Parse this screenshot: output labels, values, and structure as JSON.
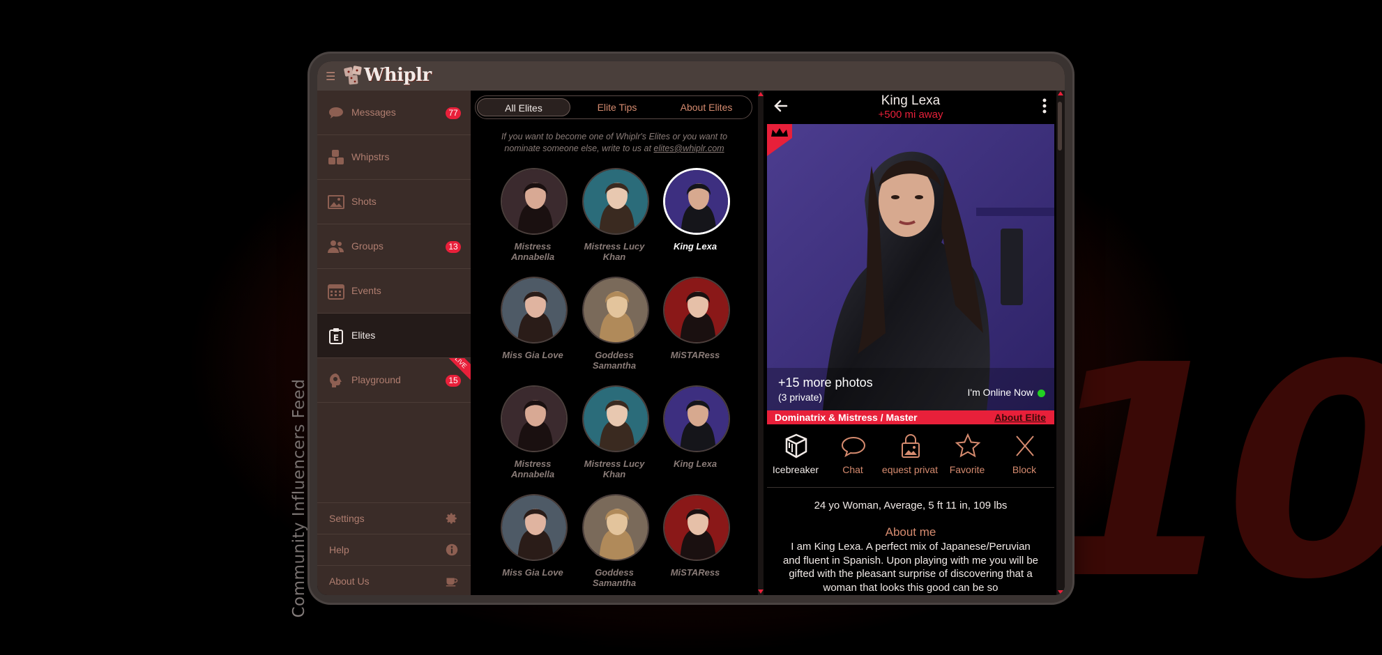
{
  "backdrop": {
    "big_number": "10",
    "vertical_caption": "Community Influencers Feed"
  },
  "app": {
    "name": "Whiplr"
  },
  "sidebar": {
    "items": [
      {
        "label": "Messages",
        "badge": "77",
        "icon": "speech-bubble-icon"
      },
      {
        "label": "Whipstrs",
        "badge": "",
        "icon": "dice-icon"
      },
      {
        "label": "Shots",
        "badge": "",
        "icon": "image-icon"
      },
      {
        "label": "Groups",
        "badge": "13",
        "icon": "people-icon"
      },
      {
        "label": "Events",
        "badge": "",
        "icon": "calendar-icon"
      },
      {
        "label": "Elites",
        "badge": "",
        "icon": "elite-badge-icon",
        "active": true
      },
      {
        "label": "Playground",
        "badge": "15",
        "icon": "playground-icon",
        "ribbon": "LIVE"
      }
    ],
    "bottom": [
      {
        "label": "Settings",
        "icon": "gear-icon"
      },
      {
        "label": "Help",
        "icon": "info-icon"
      },
      {
        "label": "About Us",
        "icon": "coffee-cup-icon"
      }
    ]
  },
  "elites": {
    "tabs": [
      "All Elites",
      "Elite Tips",
      "About Elites"
    ],
    "active_tab": "All Elites",
    "intro": "If you want to become one of Whiplr's Elites or you want to nominate someone else, write to us at",
    "email": "elites@whiplr.com",
    "cards": [
      {
        "name": "Mistress Annabella"
      },
      {
        "name": "Mistress Lucy Khan"
      },
      {
        "name": "King Lexa",
        "selected": true
      },
      {
        "name": "Miss Gia Love"
      },
      {
        "name": "Goddess Samantha"
      },
      {
        "name": "MiSTARess"
      },
      {
        "name": "Mistress Annabella"
      },
      {
        "name": "Mistress Lucy Khan"
      },
      {
        "name": "King Lexa"
      },
      {
        "name": "Miss Gia Love"
      },
      {
        "name": "Goddess Samantha"
      },
      {
        "name": "MiSTARess"
      }
    ]
  },
  "profile": {
    "name": "King Lexa",
    "distance": "+500 mi away",
    "more_photos": "+15 more photos",
    "private_photos": "(3 private)",
    "online_status": "I'm Online Now",
    "roles": "Dominatrix & Mistress / Master",
    "about_elite_link": "About Elite",
    "actions": [
      {
        "label": "Icebreaker",
        "icon": "ice-cube-icon"
      },
      {
        "label": "Chat",
        "icon": "chat-bubble-icon"
      },
      {
        "label": "equest privat",
        "icon": "lock-photo-icon"
      },
      {
        "label": "Favorite",
        "icon": "star-icon"
      },
      {
        "label": "Block",
        "icon": "x-icon"
      }
    ],
    "stats": "24 yo Woman, Average, 5 ft 11 in, 109 lbs",
    "about_heading": "About me",
    "about_text": "I am King Lexa. A perfect mix of Japanese/Peruvian and fluent in Spanish. Upon playing with me you will be gifted with the pleasant surprise of discovering that a woman that looks this good can be so"
  },
  "colors": {
    "accent": "#e8203a",
    "copper": "#d68b6f",
    "online": "#22d122"
  }
}
